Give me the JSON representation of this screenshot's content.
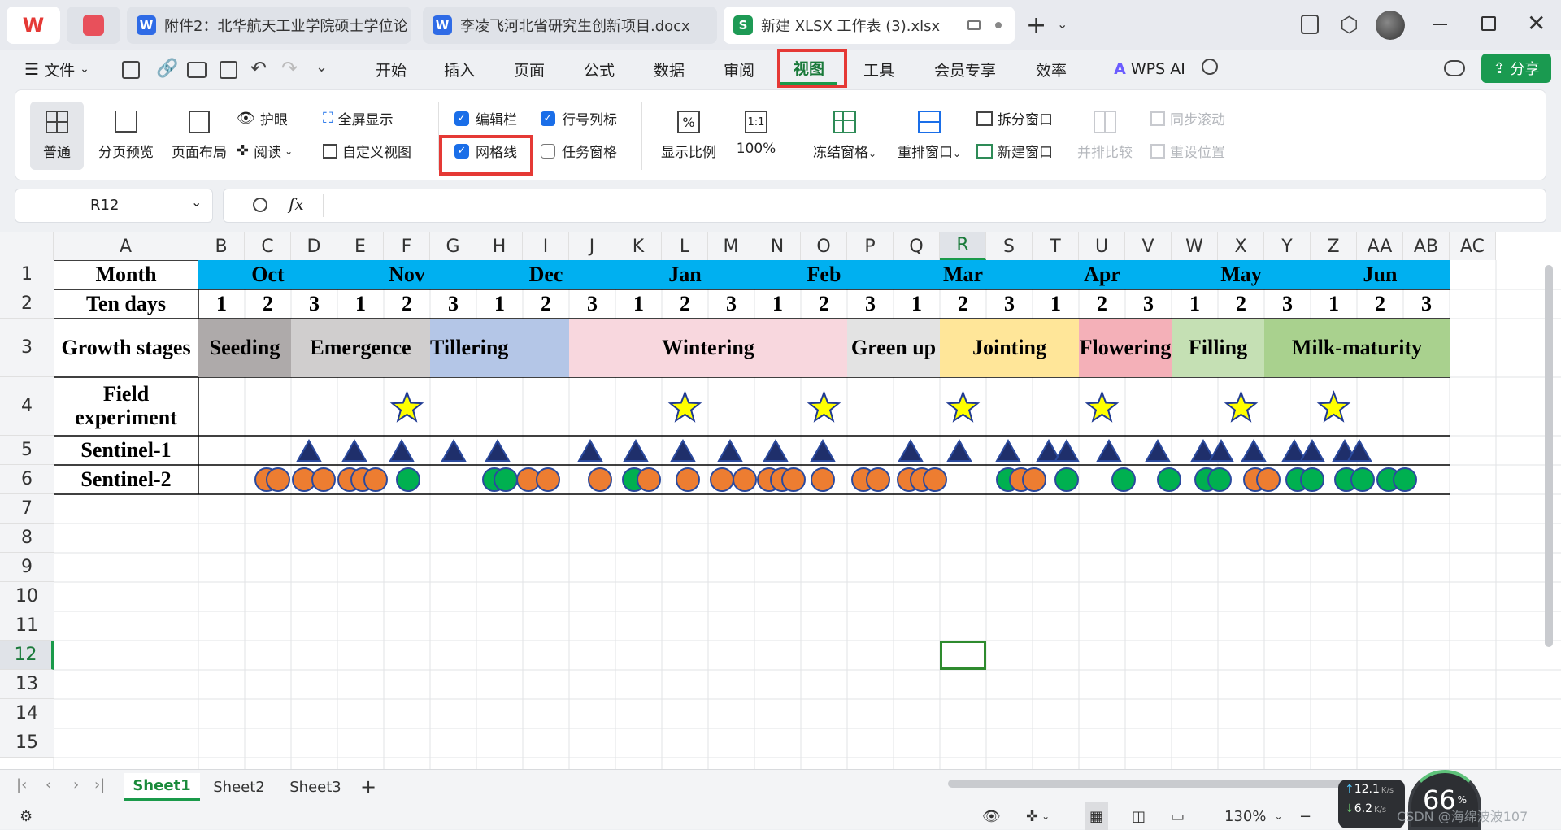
{
  "tabs": [
    {
      "label": "附件2：北华航天工业学院硕士学位论",
      "icon": "W",
      "color": "#2f6be6"
    },
    {
      "label": "李凌飞河北省研究生创新项目.docx",
      "icon": "W",
      "color": "#2f6be6"
    },
    {
      "label": "新建 XLSX 工作表 (3).xlsx",
      "icon": "S",
      "color": "#1e9a55"
    }
  ],
  "menu": {
    "file": "文件",
    "items": [
      "开始",
      "插入",
      "页面",
      "公式",
      "数据",
      "审阅",
      "视图",
      "工具",
      "会员专享",
      "效率"
    ],
    "active": "视图",
    "wps_ai": "WPS AI",
    "share": "分享"
  },
  "ribbon": {
    "normal": "普通",
    "page_break": "分页预览",
    "page_layout": "页面布局",
    "eye": "护眼",
    "reading": "阅读",
    "fullscreen": "全屏显示",
    "custom_view": "自定义视图",
    "edit_bar": "编辑栏",
    "row_col_header": "行号列标",
    "gridlines": "网格线",
    "task_pane": "任务窗格",
    "zoom_ratio": "显示比例",
    "zoom100": "100%",
    "freeze": "冻结窗格",
    "rearrange": "重排窗口",
    "split": "拆分窗口",
    "new_window": "新建窗口",
    "side_by_side": "并排比较",
    "sync_scroll": "同步滚动",
    "reset_pos": "重设位置"
  },
  "checks": {
    "edit_bar": true,
    "row_col_header": true,
    "gridlines": true,
    "task_pane": false
  },
  "name_box": "R12",
  "fx": "fx",
  "columns": [
    "A",
    "B",
    "C",
    "D",
    "E",
    "F",
    "G",
    "H",
    "I",
    "J",
    "K",
    "L",
    "M",
    "N",
    "O",
    "P",
    "Q",
    "R",
    "S",
    "T",
    "U",
    "V",
    "W",
    "X",
    "Y",
    "Z",
    "AA",
    "AB",
    "AC"
  ],
  "rows": [
    "1",
    "2",
    "3",
    "4",
    "5",
    "6",
    "7",
    "8",
    "9",
    "10",
    "11",
    "12",
    "13",
    "14",
    "15"
  ],
  "table": {
    "row_labels": [
      "Month",
      "Ten days",
      "Growth stages",
      "Field experiment",
      "Sentinel-1",
      "Sentinel-2"
    ],
    "months": [
      "Oct",
      "Nov",
      "Dec",
      "Jan",
      "Feb",
      "Mar",
      "Apr",
      "May",
      "Jun"
    ],
    "ten_days": [
      "1",
      "2",
      "3",
      "1",
      "2",
      "3",
      "1",
      "2",
      "3",
      "1",
      "2",
      "3",
      "1",
      "2",
      "3",
      "1",
      "2",
      "3",
      "1",
      "2",
      "3",
      "1",
      "2",
      "3",
      "1",
      "2",
      "3"
    ],
    "stages": [
      {
        "label": "Seeding",
        "color": "#aeaaaa"
      },
      {
        "label": "Emergence",
        "color": "#d0cece"
      },
      {
        "label": "Tillering",
        "color": "#b4c6e7"
      },
      {
        "label": "Wintering",
        "color": "#f8d7de"
      },
      {
        "label": "Green up",
        "color": "#e3e3e3"
      },
      {
        "label": "Jointing",
        "color": "#ffe699"
      },
      {
        "label": "Flowering",
        "color": "#f4b0b8"
      },
      {
        "label": "Filling",
        "color": "#c5e0b4"
      },
      {
        "label": "Milk-maturity",
        "color": "#a9d18e"
      }
    ],
    "month_color": "#00b0f0"
  },
  "selected_cell": "R12",
  "sheets": [
    "Sheet1",
    "Sheet2",
    "Sheet3"
  ],
  "active_sheet": "Sheet1",
  "status": {
    "zoom": "130%",
    "net_up": "12.1",
    "net_down": "6.2",
    "net_unit": "K/s",
    "cpu": "66",
    "cpu_unit": "%",
    "watermark": "CSDN @海绵波波107"
  }
}
